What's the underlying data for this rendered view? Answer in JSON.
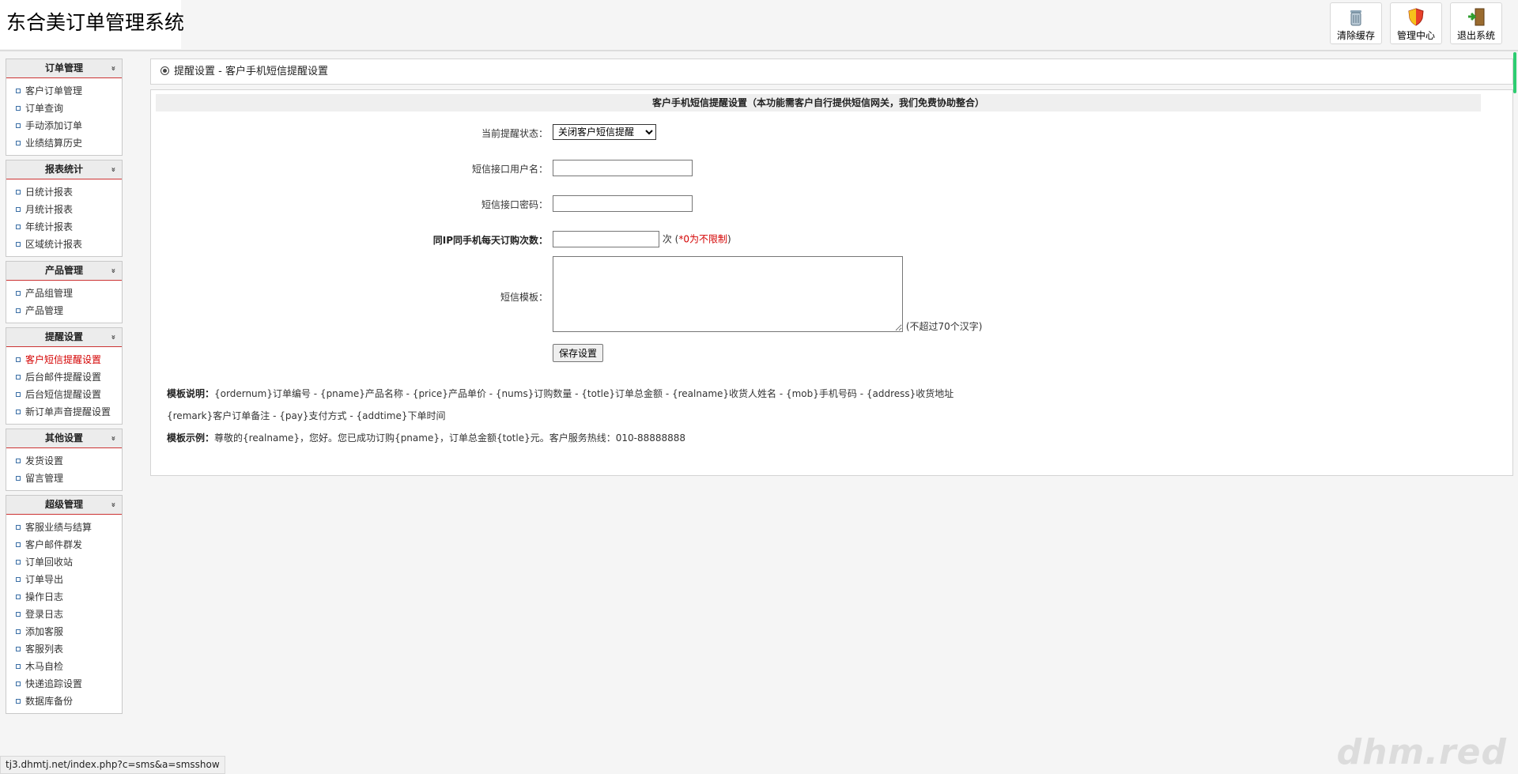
{
  "app": {
    "title": "东合美订单管理系统"
  },
  "toolbar": {
    "buttons": [
      {
        "label": "清除缓存",
        "icon": "trash-icon"
      },
      {
        "label": "管理中心",
        "icon": "shield-icon"
      },
      {
        "label": "退出系统",
        "icon": "exit-door-icon"
      }
    ]
  },
  "sidebar": {
    "groups": [
      {
        "title": "订单管理",
        "items": [
          "客户订单管理",
          "订单查询",
          "手动添加订单",
          "业绩结算历史"
        ]
      },
      {
        "title": "报表统计",
        "items": [
          "日统计报表",
          "月统计报表",
          "年统计报表",
          "区域统计报表"
        ]
      },
      {
        "title": "产品管理",
        "items": [
          "产品组管理",
          "产品管理"
        ]
      },
      {
        "title": "提醒设置",
        "items": [
          "客户短信提醒设置",
          "后台邮件提醒设置",
          "后台短信提醒设置",
          "新订单声音提醒设置"
        ],
        "active_item": "客户短信提醒设置"
      },
      {
        "title": "其他设置",
        "items": [
          "发货设置",
          "留言管理"
        ]
      },
      {
        "title": "超级管理",
        "items": [
          "客服业绩与结算",
          "客户邮件群发",
          "订单回收站",
          "订单导出",
          "操作日志",
          "登录日志",
          "添加客服",
          "客服列表",
          "木马自检",
          "快递追踪设置",
          "数据库备份"
        ]
      }
    ],
    "chevron": "»"
  },
  "breadcrumb": {
    "text": "提醒设置 - 客户手机短信提醒设置"
  },
  "form": {
    "panel_title": "客户手机短信提醒设置（本功能需客户自行提供短信网关，我们免费协助整合）",
    "status_label": "当前提醒状态：",
    "status_value": "关闭客户短信提醒",
    "username_label": "短信接口用户名：",
    "username_value": "",
    "password_label": "短信接口密码：",
    "password_value": "",
    "limit_label": "同IP同手机每天订购次数：",
    "limit_value": "",
    "limit_unit": "次",
    "limit_hint_open": " (",
    "limit_hint_red": "*0为不限制",
    "limit_hint_close": ")",
    "template_label": "短信模板：",
    "template_value": "",
    "template_hint": "(不超过70个汉字)",
    "save_label": "保存设置"
  },
  "notes": {
    "desc_label": "模板说明：",
    "desc_line1": "{ordernum}订单编号 - {pname}产品名称 - {price}产品单价 - {nums}订购数量 - {totle}订单总金额 - {realname}收货人姓名 - {mob}手机号码 - {address}收货地址",
    "desc_line2": "{remark}客户订单备注 - {pay}支付方式 - {addtime}下单时间",
    "example_label": "模板示例：",
    "example_text": "尊敬的{realname}，您好。您已成功订购{pname}，订单总金额{totle}元。客户服务热线：010-88888888"
  },
  "statusbar": {
    "url": "tj3.dhmtj.net/index.php?c=sms&a=smsshow"
  },
  "watermark": "dhm.red",
  "colors": {
    "active": "#d40000",
    "menu_rule": "#cc3333",
    "scroll_thumb": "#2ecc71"
  }
}
